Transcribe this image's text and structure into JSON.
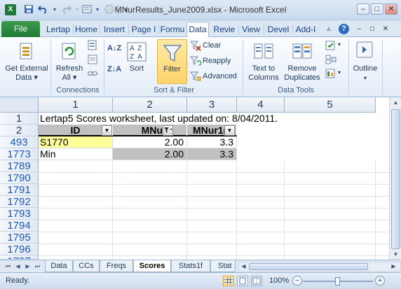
{
  "window": {
    "title": "MNurResults_June2009.xlsx - Microsoft Excel",
    "app_icon_label": "X",
    "minimize": "–",
    "maximize": "□",
    "close": "✕",
    "ribbon_min": "▵",
    "ribbon_restore": "□",
    "ribbon_close": "✕",
    "help": "?"
  },
  "quick_access": [
    "save-icon",
    "undo-icon",
    "redo-icon",
    "form-icon",
    "circle-icon",
    "customize-icon"
  ],
  "ribbon_tabs": [
    {
      "label": "File"
    },
    {
      "label": "Lertap"
    },
    {
      "label": "Home"
    },
    {
      "label": "Insert"
    },
    {
      "label": "Page I"
    },
    {
      "label": "Formu"
    },
    {
      "label": "Data"
    },
    {
      "label": "Revie"
    },
    {
      "label": "View"
    },
    {
      "label": "Devel"
    },
    {
      "label": "Add-I"
    }
  ],
  "active_tab": "Data",
  "ribbon": {
    "get_external_data": "Get External",
    "get_external_data_2": "Data ▾",
    "refresh": "Refresh",
    "refresh_2": "All ▾",
    "connections_group": "Connections",
    "sort_az": "A↓Z",
    "sort_za": "Z↓A",
    "sort": "Sort",
    "filter": "Filter",
    "clear": "Clear",
    "reapply": "Reapply",
    "advanced": "Advanced",
    "sort_filter_group": "Sort & Filter",
    "text_to_columns": "Text to",
    "text_to_columns_2": "Columns",
    "remove_duplicates": "Remove",
    "remove_duplicates_2": "Duplicates",
    "data_tools_group": "Data Tools",
    "outline": "Outline",
    "outline_2": "▾"
  },
  "sheet": {
    "columns": [
      "1",
      "2",
      "3",
      "4",
      "5"
    ],
    "rows": [
      {
        "header": "1",
        "blue": false
      },
      {
        "header": "2",
        "blue": false
      },
      {
        "header": "493",
        "blue": true
      },
      {
        "header": "1773",
        "blue": true
      },
      {
        "header": "1789",
        "blue": true
      },
      {
        "header": "1790",
        "blue": true
      },
      {
        "header": "1791",
        "blue": true
      },
      {
        "header": "1792",
        "blue": true
      },
      {
        "header": "1793",
        "blue": true
      },
      {
        "header": "1794",
        "blue": true
      },
      {
        "header": "1795",
        "blue": true
      },
      {
        "header": "1796",
        "blue": true
      },
      {
        "header": "1797",
        "blue": true
      }
    ],
    "row1_text": "Lertap5 Scores worksheet, last updated on: 8/04/2011.",
    "header_row": [
      "ID",
      "MNu",
      "MNur1("
    ],
    "data_rows": [
      [
        "S1770",
        "2.00",
        "3.3"
      ],
      [
        "Min",
        "2.00",
        "3.3"
      ]
    ]
  },
  "sheet_tabs": [
    "Data",
    "CCs",
    "Freqs",
    "Scores",
    "Stats1f",
    "Stat"
  ],
  "active_sheet": "Scores",
  "status": {
    "ready": "Ready.",
    "zoom": "100%",
    "zoom_out": "−",
    "zoom_in": "+",
    "zoom_level": 0.5
  }
}
